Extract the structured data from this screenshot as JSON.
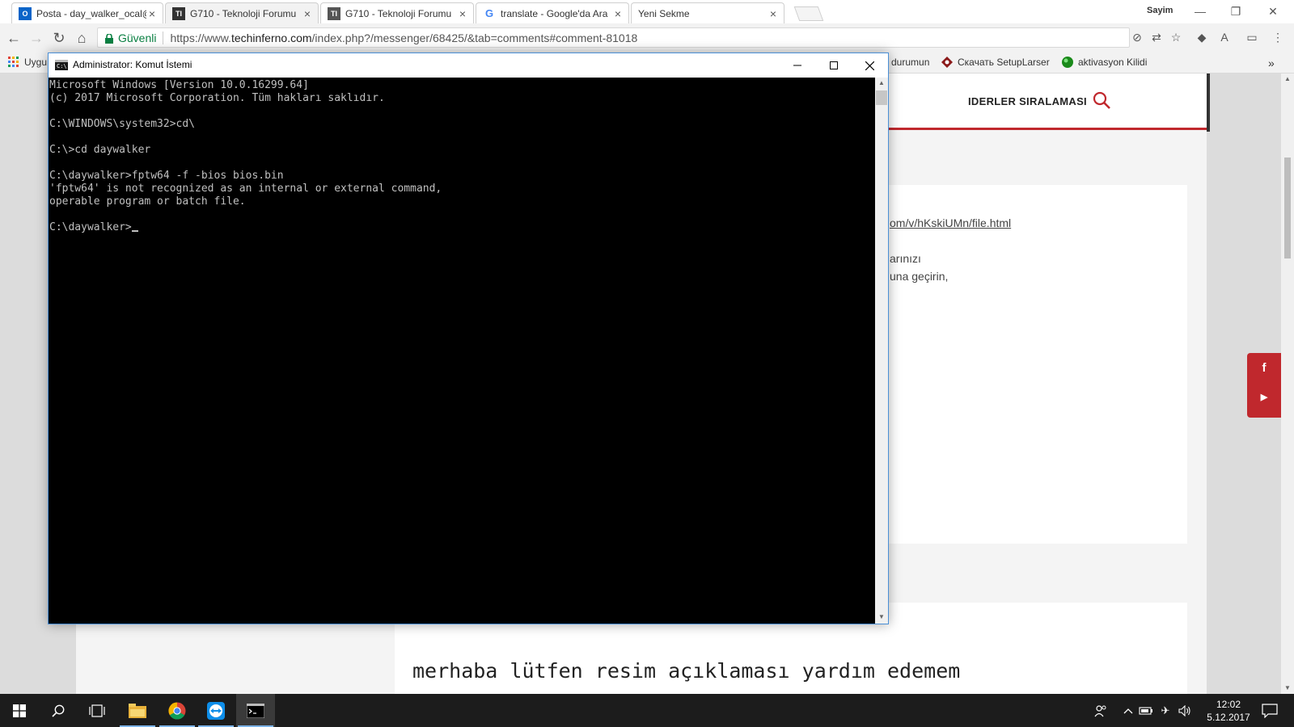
{
  "browser": {
    "tabs": [
      {
        "title": "Posta - day_walker_ocal@",
        "favicon": "outlook-icon",
        "active": false
      },
      {
        "title": "G710 - Teknoloji Forumu",
        "favicon": "techinferno-icon",
        "active": true
      },
      {
        "title": "G710 - Teknoloji Forumu",
        "favicon": "techinferno-icon",
        "active": false
      },
      {
        "title": "translate - Google'da Ara",
        "favicon": "google-icon",
        "active": false
      },
      {
        "title": "Yeni Sekme",
        "favicon": "",
        "active": false
      }
    ],
    "profile_name": "Sayim",
    "omnibox": {
      "secure_label": "Güvenli",
      "url_prefix": "https://www.",
      "url_host": "techinferno.com",
      "url_path": "/index.php?/messenger/68425/&tab=comments#comment-81018"
    },
    "bookmarks": [
      {
        "label": "Uygu",
        "icon": "apps-grid-icon"
      },
      {
        "label": "durumun",
        "icon": ""
      },
      {
        "label": "Скачать SetupLarser",
        "icon": "setup-icon"
      },
      {
        "label": "aktivasyon Kilidi",
        "icon": "green-circle-icon"
      }
    ]
  },
  "webpage": {
    "nav_label": "IDERLER SIRALAMASI",
    "file_link": "om/v/hKskiUMn/file.html",
    "comment_lines": [
      "arınızı",
      "una geçirin,"
    ],
    "reply_text": "merhaba lütfen resim açıklaması yardım edemem",
    "social": [
      "f",
      "▶"
    ],
    "colors": {
      "accent": "#c0282d"
    }
  },
  "cmd": {
    "title": "Administrator: Komut İstemi",
    "output": "Microsoft Windows [Version 10.0.16299.64]\n(c) 2017 Microsoft Corporation. Tüm hakları saklıdır.\n\nC:\\WINDOWS\\system32>cd\\\n\nC:\\>cd daywalker\n\nC:\\daywalker>fptw64 -f -bios bios.bin\n'fptw64' is not recognized as an internal or external command,\noperable program or batch file.\n",
    "prompt": "C:\\daywalker>"
  },
  "taskbar": {
    "apps": [
      "start-icon",
      "search-icon",
      "task-view-icon",
      "file-explorer-icon",
      "chrome-icon",
      "teamviewer-icon",
      "cmd-icon"
    ],
    "clock_time": "12:02",
    "clock_date": "5.12.2017"
  }
}
